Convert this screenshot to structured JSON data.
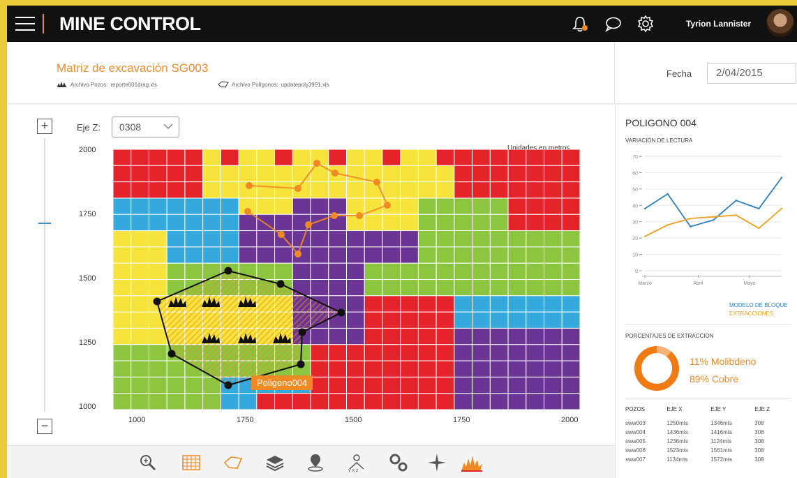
{
  "topbar": {
    "title": "MINE CONTROL",
    "user_name": "Tyrion Lannister",
    "icons": [
      "menu-icon",
      "bell-icon",
      "chat-icon",
      "gear-icon"
    ],
    "accent": "#f08a24"
  },
  "header": {
    "doc_title": "Matriz de excavación SG003",
    "file_pozos_label": "Archivo Pozos:",
    "file_pozos_value": "reporte001drag.xls",
    "file_poligonos_label": "Archivo Polígonos:",
    "file_poligonos_value": "updatepoly3991.xls",
    "fecha_label": "Fecha",
    "fecha_value": "2/04/2015"
  },
  "main": {
    "eje_z_label": "Eje Z:",
    "eje_z_value": "0308",
    "zoom_in": "+",
    "zoom_out": "−",
    "units_label": "Unidades en metros",
    "polygon_tag": "Poligono004",
    "y_ticks": [
      "2000",
      "1750",
      "1500",
      "1250",
      "1000"
    ],
    "x_ticks": [
      "1000",
      "1750",
      "1500",
      "1750",
      "2000"
    ],
    "palette": {
      "red": "#e4232a",
      "yellow": "#f6e33c",
      "blue": "#35a8dc",
      "green": "#8cc540",
      "purple": "#6a3593",
      "orange": "#f08a24"
    }
  },
  "toolbar": {
    "tools": [
      "search-icon",
      "grid-icon",
      "polygon-icon",
      "layers-icon",
      "pin-icon",
      "xyz-axis-icon",
      "gears-icon",
      "compass-icon",
      "explosion-icon"
    ]
  },
  "side": {
    "title": "POLIGONO 004",
    "variacion_label": "VARIACIÓN DE LECTURA",
    "legend_blue": "MODELO DE BLOQUE",
    "legend_orange": "EXTRACCIONES",
    "porcentajes_label": "PORCENTAJES DE EXTRACCION",
    "pct_molibdeno": "11% Molibdeno",
    "pct_cobre": "89% Cobre",
    "table": {
      "headers": [
        "POZOS",
        "EJE X",
        "EJE Y",
        "EJE Z"
      ],
      "rows": [
        [
          "sww003",
          "1250mts",
          "1346mts",
          "308"
        ],
        [
          "sww004",
          "1436mts",
          "1416mts",
          "308"
        ],
        [
          "sww005",
          "1236mts",
          "1124mts",
          "308"
        ],
        [
          "sww006",
          "1523mts",
          "1561mts",
          "308"
        ],
        [
          "sww007",
          "1134mts",
          "1572mts",
          "308"
        ]
      ]
    }
  },
  "chart_data": [
    {
      "type": "line",
      "title": "VARIACIÓN DE LECTURA",
      "x_tick_labels": [
        "Marzo",
        "Abril",
        "Mayo"
      ],
      "y_ticks": [
        0,
        10,
        20,
        30,
        40,
        50,
        60,
        70
      ],
      "ylim": [
        0,
        70
      ],
      "series": [
        {
          "name": "MODELO DE BLOQUE",
          "color": "#2f7fc1",
          "values": [
            38,
            47,
            27,
            31,
            43,
            38,
            57
          ]
        },
        {
          "name": "EXTRACCIONES",
          "color": "#f0a020",
          "values": [
            21,
            28,
            32,
            33,
            34,
            26,
            38
          ]
        }
      ],
      "grid": true
    },
    {
      "type": "pie",
      "title": "PORCENTAJES DE EXTRACCION",
      "categories": [
        "Molibdeno",
        "Cobre"
      ],
      "values": [
        11,
        89
      ]
    }
  ]
}
